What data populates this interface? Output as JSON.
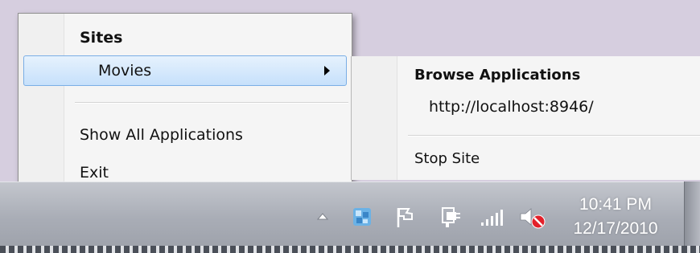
{
  "menu": {
    "header": "Sites",
    "movies_label": "Movies",
    "show_all_label": "Show All Applications",
    "exit_label": "Exit"
  },
  "submenu": {
    "browse_label": "Browse Applications",
    "url": "http://localhost:8946/",
    "stop_label": "Stop Site"
  },
  "tray": {
    "icons": [
      "show-hidden-icons-arrow",
      "iis-express-icon",
      "action-center-flag-icon",
      "power-plug-icon",
      "network-signal-icon",
      "volume-muted-icon"
    ],
    "time": "10:41 PM",
    "date": "12/17/2010"
  },
  "colors": {
    "desktop": "#d6cedf",
    "menu_background": "#f5f5f5",
    "highlight": "#c6e0fb",
    "highlight_border": "#7aaee5"
  }
}
